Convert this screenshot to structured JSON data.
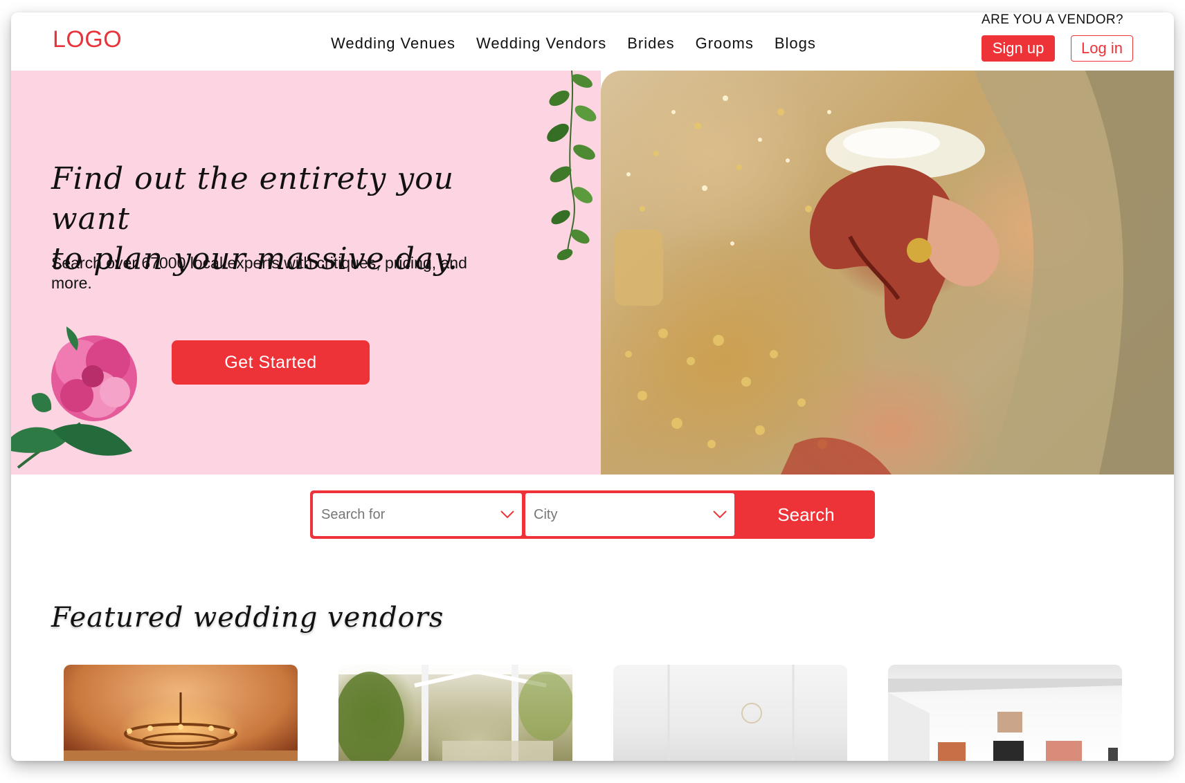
{
  "header": {
    "logo": "LOGO",
    "nav": [
      "Wedding Venues",
      "Wedding Vendors",
      "Brides",
      "Grooms",
      "Blogs"
    ],
    "vendor_question": "ARE YOU A VENDOR?",
    "signup_label": "Sign up",
    "login_label": "Log in"
  },
  "hero": {
    "title_line1": "Find out the entirety you want",
    "title_line2": "to plan your massive day.",
    "subtitle": "Search over 67000 local experts with critiques, pricing, and more.",
    "cta_label": "Get Started",
    "image": "bride-groom-hands-photo"
  },
  "search": {
    "search_for_placeholder": "Search for",
    "city_placeholder": "City",
    "button_label": "Search"
  },
  "featured": {
    "title": "Featured wedding vendors",
    "cards": [
      {
        "image": "chandelier-hall-photo"
      },
      {
        "image": "garden-venue-photo"
      },
      {
        "image": "white-tent-photo"
      },
      {
        "image": "photo-gallery-studio"
      }
    ]
  },
  "colors": {
    "accent": "#ee3338",
    "hero_pink": "#fdd5e2"
  }
}
